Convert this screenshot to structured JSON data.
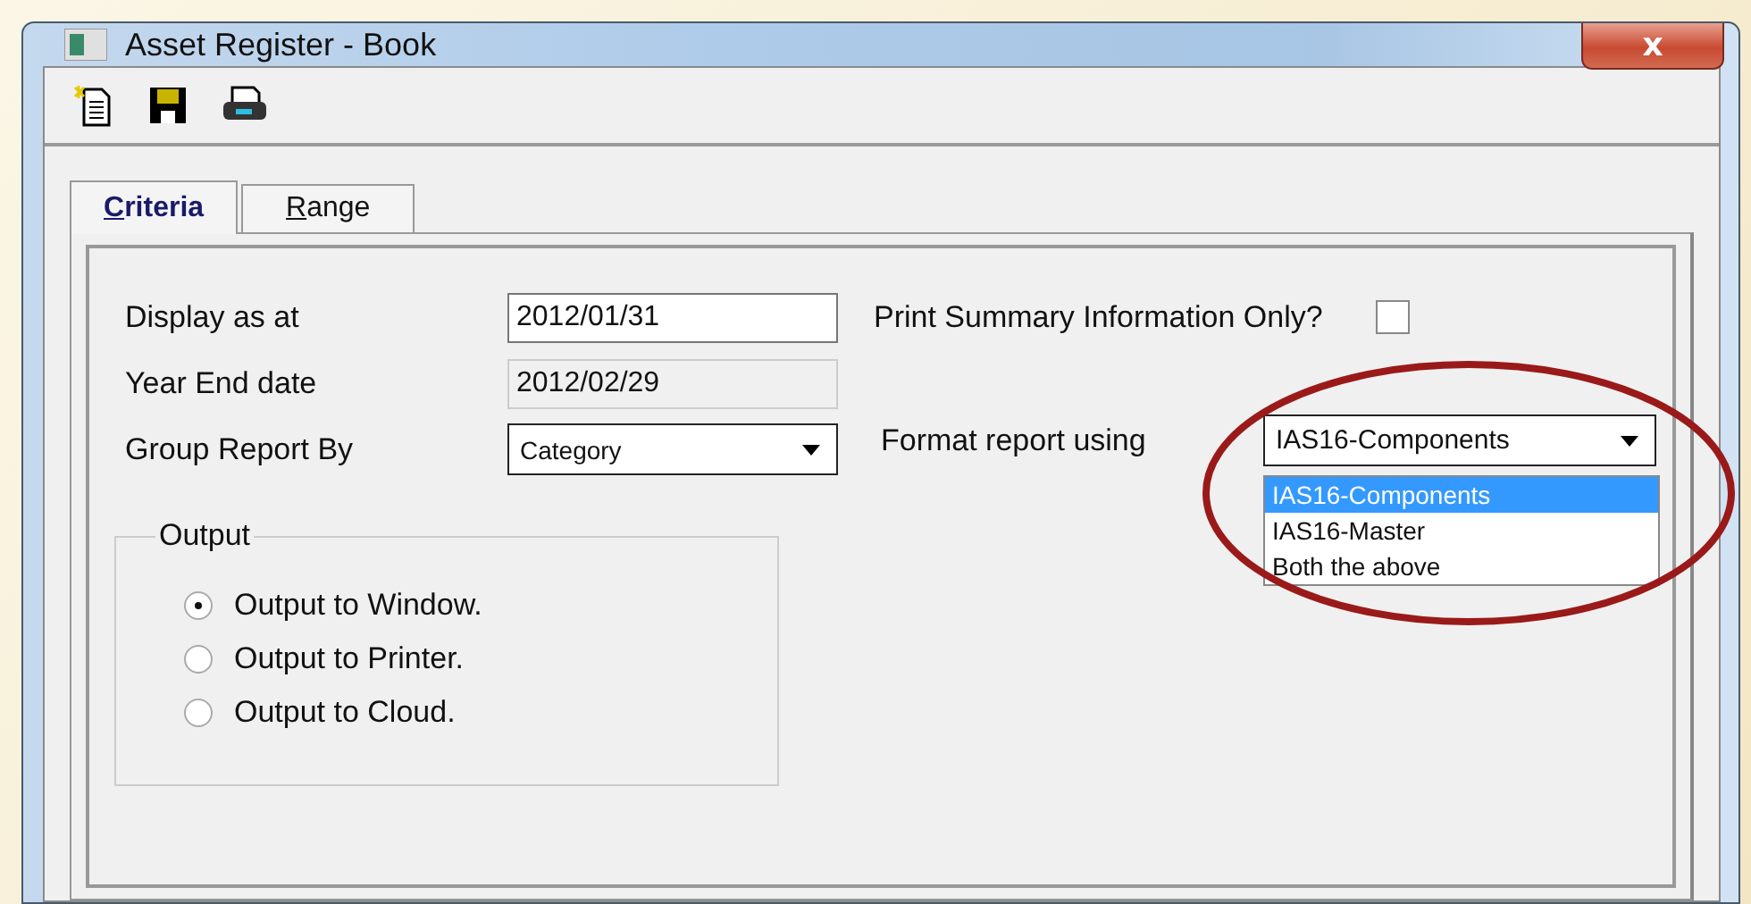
{
  "window": {
    "title": "Asset Register - Book",
    "close_label": "x"
  },
  "toolbar": [
    {
      "kind": "new"
    },
    {
      "kind": "save"
    },
    {
      "kind": "print"
    }
  ],
  "tabs": [
    {
      "label": "Criteria",
      "selected": true
    },
    {
      "label": "Range",
      "selected": false
    }
  ],
  "fields": [
    {
      "label": "Display as at",
      "kind": "text",
      "value": "2012/01/31",
      "disabled": false
    },
    {
      "label": "Year End date",
      "kind": "text",
      "value": "2012/02/29",
      "disabled": true
    },
    {
      "label": "Group Report By",
      "kind": "combo",
      "value": "Category",
      "disabled": false
    }
  ],
  "summary_only": {
    "label": "Print Summary Information Only?",
    "checked": false
  },
  "format": {
    "label": "Format report using",
    "value": "IAS16-Components",
    "expanded": true,
    "options": [
      {
        "label": "IAS16-Components",
        "selected": true
      },
      {
        "label": "IAS16-Master",
        "selected": false
      },
      {
        "label": "Both the above",
        "selected": false
      }
    ]
  },
  "output": {
    "title": "Output",
    "options": [
      {
        "label": "Output to Window.",
        "selected": true
      },
      {
        "label": "Output to Printer.",
        "selected": false
      },
      {
        "label": "Output to Cloud.",
        "selected": false
      }
    ]
  },
  "annotation": {
    "kind": "ellipse"
  }
}
